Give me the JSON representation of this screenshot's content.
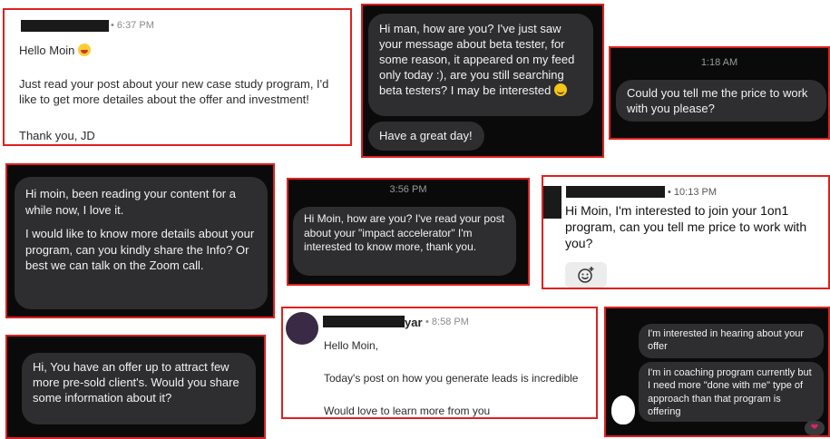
{
  "msg1": {
    "time": "• 6:37 PM",
    "greeting": "Hello Moin",
    "emoji": "grinning-face-emoji",
    "body": "Just read your post about your new case study program, I'd like to get more detailes about the offer and investment!",
    "signoff": "Thank you, JD"
  },
  "msg2": {
    "bubble1": "Hi man, how are you? I've just saw your message about beta tester, for some reason, it appeared on my feed only today :), are you still searching beta testers? I may be interested",
    "emoji": "smiling-face-emoji",
    "bubble2": "Have a great day!"
  },
  "msg3": {
    "time": "1:18 AM",
    "bubble": "Could you tell me the price to work with you please?"
  },
  "msg4": {
    "para1": "Hi moin, been reading your content for a while now, I love it.",
    "para2": "I would like to know more details about your program, can you kindly share the Info? Or best we can talk on the Zoom call."
  },
  "msg5": {
    "time": "3:56 PM",
    "bubble": "Hi Moin, how are you? I've read your post about your \"impact accelerator\" I'm interested to know more, thank you."
  },
  "msg6": {
    "time": "• 10:13 PM",
    "body": "Hi Moin, I'm interested to join your 1on1 program, can you tell me price to work with you?",
    "reaction_icon": "add-reaction-icon"
  },
  "msg7": {
    "bubble": "Hi, You have an offer up to attract few more pre-sold client's. Would you share some information about it?"
  },
  "msg8": {
    "name_suffix": "yar",
    "time": "• 8:58 PM",
    "greeting": "Hello Moin,",
    "line1": "Today's post on how you generate leads is incredible",
    "line2": "Would love to learn more from you"
  },
  "msg9": {
    "bubble1": "I'm interested in hearing about your offer",
    "bubble2": "I'm in coaching program currently but I need more \"done with me\" type of approach than that program is offering",
    "reaction": "heart-reaction-icon"
  }
}
